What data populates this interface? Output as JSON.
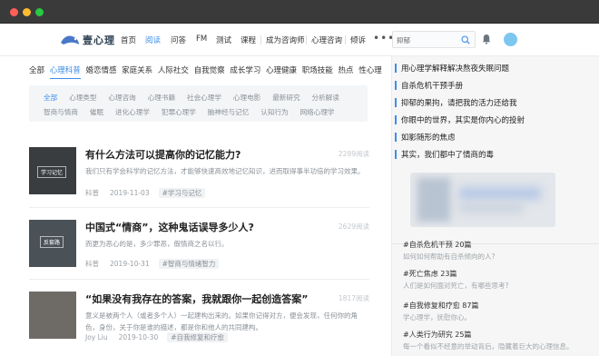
{
  "nav": {
    "logo_text": "壹心理",
    "items": [
      "首页",
      "阅读",
      "问答",
      "FM",
      "测试",
      "课程",
      "成为咨询师",
      "心理咨询",
      "倾诉"
    ],
    "more": "•••",
    "search_value": "抑郁"
  },
  "categories": [
    "全部",
    "心理科普",
    "婚恋情感",
    "家庭关系",
    "人际社交",
    "自我觉察",
    "成长学习",
    "心理健康",
    "职场技能",
    "热点",
    "性心理"
  ],
  "subcategories_row1": [
    "全部",
    "心理类型",
    "心理咨询",
    "心理书籍",
    "社会心理学",
    "心理电影",
    "最新研究",
    "分析解读"
  ],
  "subcategories_row2": [
    "智商与情商",
    "催眠",
    "进化心理学",
    "犯罪心理学",
    "脑神经与记忆",
    "认知行为",
    "网络心理学"
  ],
  "articles": [
    {
      "title": "有什么方法可以提高你的记忆能力?",
      "reads": "2289阅读",
      "desc": "我们只有学会科学的记忆方法，才能够快速高效地记忆知识，进而取得事半功倍的学习效果。",
      "author": "科普",
      "date": "2019-11-03",
      "tag": "#学习与记忆",
      "thumb_label": "学习记忆"
    },
    {
      "title": "中国式“情商”，这种鬼话误导多少人?",
      "reads": "2629阅读",
      "desc": "而更为恶心的是，多少罪恶，假情商之名以行。",
      "author": "科普",
      "date": "2019-10-31",
      "tag": "#智商与情绪智力",
      "thumb_label": "反套路"
    },
    {
      "title": "“如果没有我存在的答案，我就跟你一起创造答案”",
      "reads": "1817阅读",
      "desc": "意义是被两个人（或者多个人）一起建构出来的。如果你记得对方，便会发现，任何你的角色，身份，关于你是谁的描述，都是你和他人的共同建构。",
      "author": "Joy Liu",
      "date": "2019-10-30",
      "tag": "#自我修复和疗愈",
      "thumb_label": ""
    }
  ],
  "sidebar": {
    "links": [
      "用心理学解释解决熬夜失眠问题",
      "自杀危机干预手册",
      "抑郁的果拘，请把我的活力还给我",
      "你眼中的世界，其实是你内心的投射",
      "如影随形的焦虑",
      "其实，我们都中了情商的毒"
    ],
    "topics": [
      {
        "title": "#自杀危机干预 20篇",
        "desc": "如何如何帮助有自杀倾向的人?"
      },
      {
        "title": "#死亡焦虑 23篇",
        "desc": "人们是如何面对死亡，有哪些思考?"
      },
      {
        "title": "#自我修复和疗愈 87篇",
        "desc": "学心理学，抚慰你心。"
      },
      {
        "title": "#人类行为研究 25篇",
        "desc": "每一个看似不经意的举动背后，隐藏着巨大的心理信息。"
      }
    ]
  },
  "colors": {
    "accent": "#3d8ee8",
    "titlebar": "#3a3a3a",
    "sidebar_bg": "#f6f6f6"
  }
}
